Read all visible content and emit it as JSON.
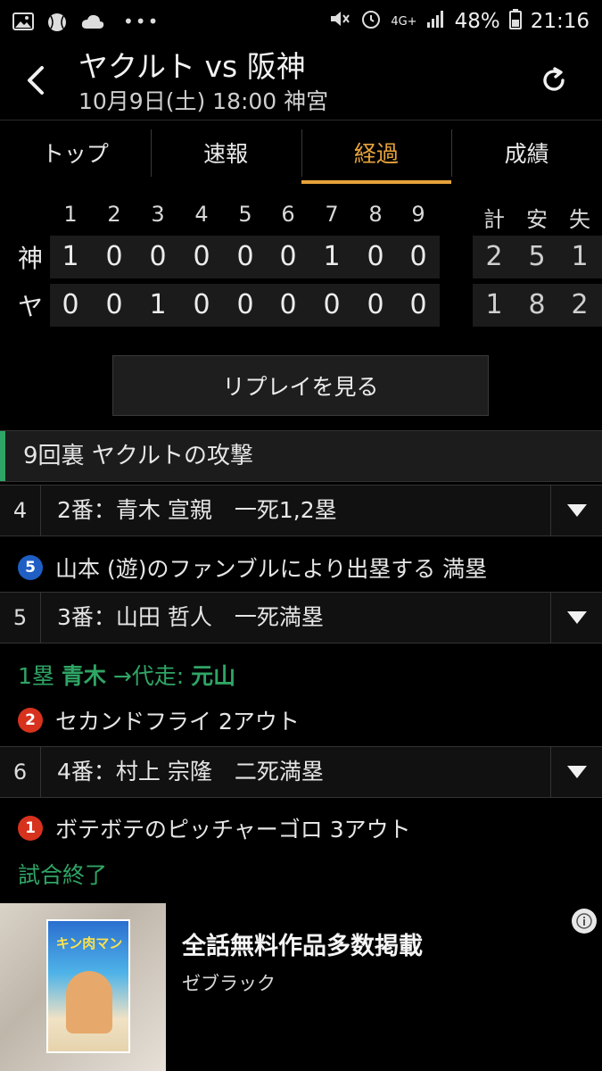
{
  "status_bar": {
    "network": "4G+",
    "battery": "48%",
    "time": "21:16",
    "dots": "•••",
    "left_icons": [
      "image-icon",
      "baseball-icon",
      "cloud-icon"
    ],
    "right_icons": [
      "mute-icon",
      "alarm-icon",
      "signal-icon",
      "battery-icon"
    ]
  },
  "header": {
    "title": "ヤクルト vs 阪神",
    "subtitle": "10月9日(土) 18:00 神宮"
  },
  "tabs": [
    {
      "label": "トップ",
      "active": false
    },
    {
      "label": "速報",
      "active": false
    },
    {
      "label": "経過",
      "active": true
    },
    {
      "label": "成績",
      "active": false
    }
  ],
  "scoreboard": {
    "innings": [
      "1",
      "2",
      "3",
      "4",
      "5",
      "6",
      "7",
      "8",
      "9"
    ],
    "total_headers": [
      "計",
      "安",
      "失"
    ],
    "teams": [
      {
        "label": "神",
        "scores": [
          "1",
          "0",
          "0",
          "0",
          "0",
          "0",
          "1",
          "0",
          "0"
        ],
        "totals": [
          "2",
          "5",
          "1"
        ]
      },
      {
        "label": "ヤ",
        "scores": [
          "0",
          "0",
          "1",
          "0",
          "0",
          "0",
          "0",
          "0",
          "0"
        ],
        "totals": [
          "1",
          "8",
          "2"
        ]
      }
    ]
  },
  "replay_button": "リプレイを見る",
  "log": {
    "section": "9回裏 ヤクルトの攻撃",
    "batters": [
      {
        "num": "4",
        "info": "2番：青木 宣親　一死1,2塁"
      },
      {
        "num": "5",
        "info": "3番：山田 哲人　一死満塁"
      },
      {
        "num": "6",
        "info": "4番：村上 宗隆　二死満塁"
      }
    ],
    "events": {
      "e1": {
        "badge": "5",
        "text": "山本 (遊)のファンブルにより出塁する 満塁"
      },
      "sub": {
        "pre": "1塁 ",
        "runner": "青木",
        "mid": " →代走: ",
        "sub_runner": "元山"
      },
      "e2": {
        "badge": "2",
        "text": "セカンドフライ 2アウト"
      },
      "e3": {
        "badge": "1",
        "text": "ボテボテのピッチャーゴロ 3アウト"
      },
      "end": "試合終了"
    }
  },
  "ad": {
    "headline": "全話無料作品多数掲載",
    "sub": "ゼブラック",
    "cover_title": "キン肉マン"
  },
  "colors": {
    "accent": "#e6a33a",
    "green": "#2fa565",
    "badge_blue": "#1f5fc4",
    "badge_red": "#d7321e"
  }
}
